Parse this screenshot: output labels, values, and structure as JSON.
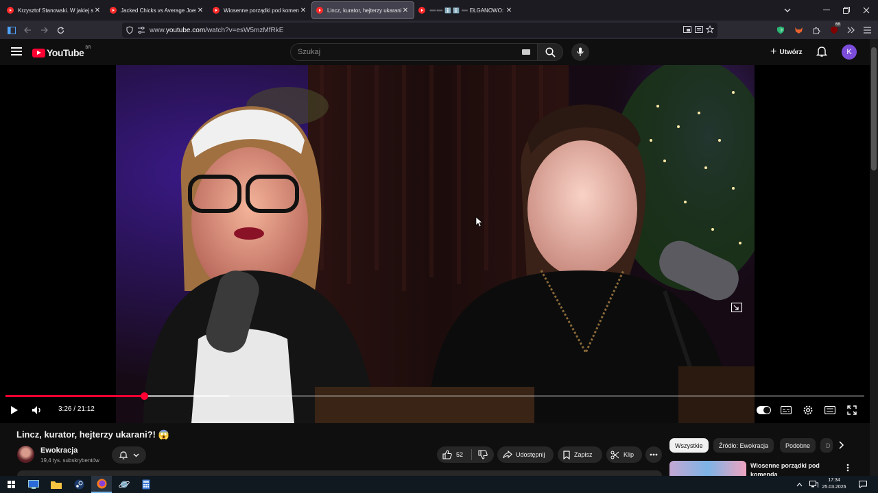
{
  "browser": {
    "tabs": [
      {
        "title": "Krzysztof Stanowski. W jakiej sp",
        "active": false
      },
      {
        "title": "Jacked Chicks vs Average Joes |",
        "active": false
      },
      {
        "title": "Wiosenne porządki pod komen",
        "active": false
      },
      {
        "title": "Lincz, kurator, hejterzy ukarani?",
        "active": true
      },
      {
        "title": "➖➖ ℹ️ ℹ️ ➖ EŁGANOWO: D",
        "active": false
      }
    ],
    "url_prefix": "www.",
    "url_domain": "youtube.com",
    "url_path": "/watch?v=esW5mzMfRkE",
    "extension_badge": "68"
  },
  "youtube": {
    "logo_text": "YouTube",
    "country_code": "BR",
    "search_placeholder": "Szukaj",
    "create_label": "Utwórz",
    "avatar_letter": "K"
  },
  "player": {
    "current_time": "3:26",
    "duration": "21:12",
    "progress_fraction": 0.162,
    "buffered_fraction": 0.26,
    "time_separator": " / "
  },
  "video": {
    "title": "Lincz, kurator, hejterzy ukarani?! 😱",
    "channel_name": "Ewokracja",
    "subscribers": "19,4 tys. subskrybentów",
    "likes": "52",
    "share_label": "Udostępnij",
    "save_label": "Zapisz",
    "clip_label": "Klip"
  },
  "sidebar": {
    "chips": [
      "Wszystkie",
      "Źródło: Ewokracja",
      "Podobne",
      "D"
    ],
    "selected_chip": "Wszystkie",
    "recommendation_title": "Wiosenne porządki pod komenda"
  },
  "taskbar": {
    "time": "17:34",
    "date": "25.03.2026"
  },
  "colors": {
    "youtube_red": "#ff0033",
    "background": "#0f0f0f",
    "avatar_purple": "#7c4ddb"
  }
}
